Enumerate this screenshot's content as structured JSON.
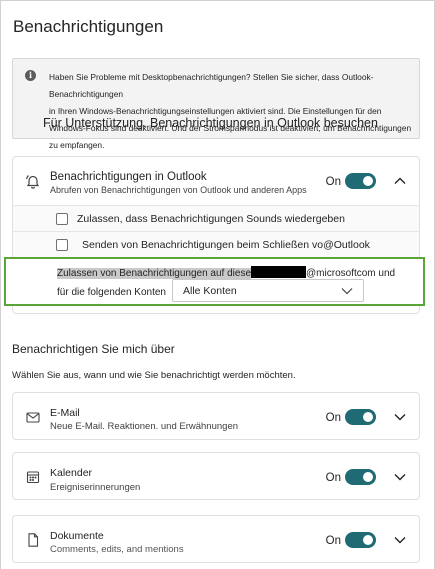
{
  "page": {
    "title": "Benachrichtigungen"
  },
  "info": {
    "line1": "Haben Sie Probleme mit Desktopbenachrichtigungen? Stellen Sie sicher, dass Outlook-Benachrichtigungen",
    "line2": "in Ihren Windows-Benachrichtigungseinstellungen aktiviert sind. Die Einstellungen für den",
    "line3": "Windows-Fokus sind deaktiviert. Und der Stromsparmodus ist deaktiviert, um Benachrichtigungen zu empfangen.",
    "link": "Für Unterstützung. Benachrichtigungen in Outlook besuchen"
  },
  "outlook": {
    "title": "Benachrichtigungen in Outlook",
    "subtitle": "Abrufen von Benachrichtigungen von Outlook und anderen Apps",
    "on_label": "On",
    "sounds_label": "Zulassen, dass Benachrichtigungen Sounds wiedergeben",
    "close_label": "Senden von Benachrichtigungen beim Schließen vo@Outlook",
    "allow_prefix": "Zulassen von Benachrichtigungen auf diese",
    "allow_suffix": "@microsoftcom und",
    "accounts_label": "für die folgenden Konten",
    "accounts_value": "Alle Konten"
  },
  "notify": {
    "title": "Benachrichtigen Sie mich über",
    "description": "Wählen Sie aus, wann und wie Sie benachrichtigt werden möchten."
  },
  "items": [
    {
      "title": "E-Mail",
      "subtitle": "Neue E-Mail. Reaktionen. und Erwähnungen",
      "on_label": "On",
      "icon": "mail-icon"
    },
    {
      "title": "Kalender",
      "subtitle": "Ereigniserinnerungen",
      "on_label": "On",
      "icon": "calendar-icon"
    },
    {
      "title": "Dokumente",
      "subtitle": "Comments, edits, and mentions",
      "on_label": "On",
      "icon": "document-icon"
    }
  ],
  "colors": {
    "toggle_on": "#1f6a73",
    "highlight_border": "#5aa538"
  }
}
